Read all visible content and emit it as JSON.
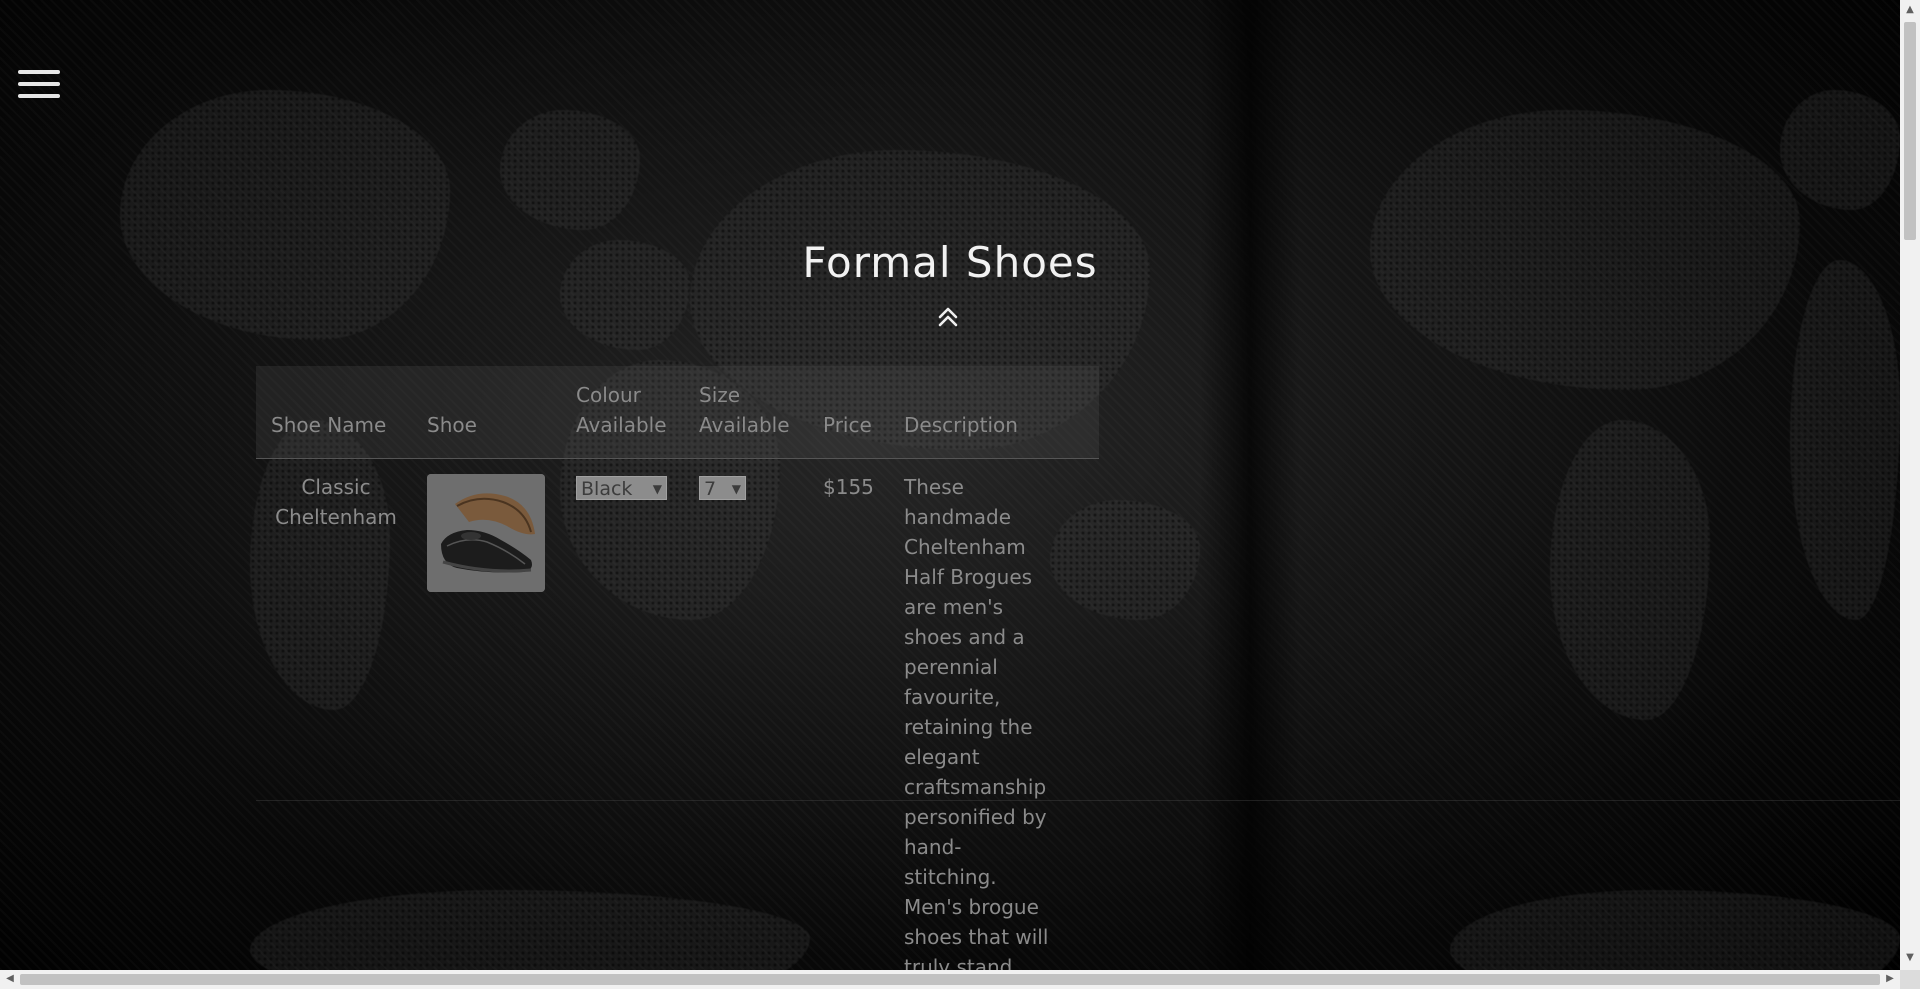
{
  "page": {
    "title": "Formal Shoes"
  },
  "icons": {
    "menu": "hamburger-menu-icon",
    "collapse": "double-chevron-up-icon"
  },
  "table": {
    "headers": {
      "shoe_name": "Shoe Name",
      "shoe": "Shoe",
      "colour_line1": "Colour",
      "colour_line2": "Available",
      "size_line1": "Size",
      "size_line2": "Available",
      "price": "Price",
      "description": "Description"
    },
    "rows": [
      {
        "name_line1": "Classic",
        "name_line2": "Cheltenham",
        "colour_selected": "Black",
        "size_selected": "7",
        "price": "$155",
        "description_lines": [
          "These",
          "handmade",
          "Cheltenham",
          "Half Brogues",
          "are men's",
          "shoes and a",
          "perennial",
          "favourite,",
          "retaining the",
          "elegant",
          "craftsmanship",
          "personified by",
          "hand-",
          "stitching.",
          "Men's brogue",
          "shoes that will",
          "truly stand"
        ]
      }
    ]
  },
  "colors": {
    "title": "#f2f2f2",
    "table_text": "#8b8b8b"
  }
}
